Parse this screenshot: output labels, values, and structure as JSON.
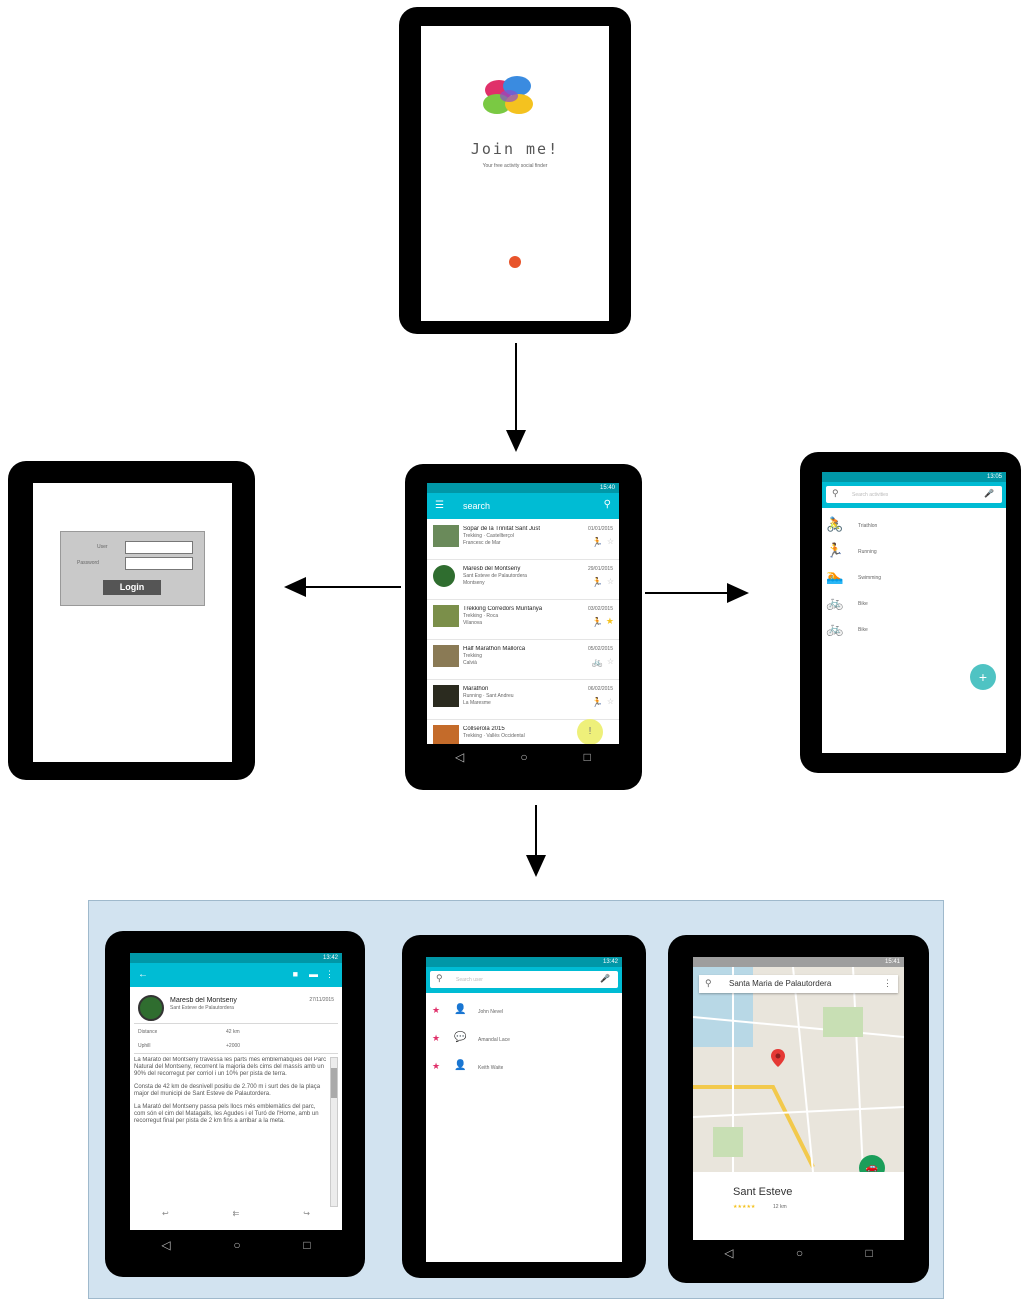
{
  "splash": {
    "title": "Join me!",
    "subtitle": "Your free activity social finder",
    "accent_dot_color": "#e8542b"
  },
  "login": {
    "user_label": "User",
    "password_label": "Password",
    "login_button": "Login"
  },
  "main_list": {
    "status_time": "15:40",
    "search_placeholder": "search",
    "items": [
      {
        "title": "Sopar de la Trinitat Sant Just",
        "sub": "Trekking · Castellterçol",
        "sub2": "Francesc de Mar",
        "date": "01/01/2015"
      },
      {
        "title": "Maresb del Montseny",
        "sub": "Sant Esteve de Palautordera",
        "sub2": "Montseny",
        "date": "29/01/2015"
      },
      {
        "title": "Trekking Corredors Muntanya",
        "sub": "Trekking · Roca",
        "sub2": "Vilanova",
        "date": "03/02/2015"
      },
      {
        "title": "Half Marathon Mallorca",
        "sub": "Trekking",
        "sub2": "Calvià",
        "date": "05/02/2015"
      },
      {
        "title": "Marathon",
        "sub": "Running · Sant Andreu",
        "sub2": "La Maresme",
        "date": "06/02/2015"
      },
      {
        "title": "Collserola 2015",
        "sub": "Trekking · Vallès Occidental",
        "sub2": "",
        "date": ""
      }
    ]
  },
  "sports": {
    "status_time": "13:05",
    "search_placeholder": "Search activities",
    "items": [
      "Triathlon",
      "Running",
      "Swimming",
      "Bike",
      "Bike"
    ],
    "fab_label": "+"
  },
  "detail": {
    "status_time": "13:42",
    "title": "Maresb del Montseny",
    "subtitle": "Sant Esteve de Palautordera",
    "date": "27/11/2015",
    "row1_label": "Distance",
    "row1_value": "42 km",
    "row2_label": "Uphill",
    "row2_value": "+2000",
    "paragraph1": "La Marató del Montseny travessa les parts més emblemàtiques del Parc Natural del Montseny, recorrent la majoria dels cims del massís amb un 90% del recorregut per corriol i un 10% per pista de terra.",
    "paragraph2": "Consta de 42 km de desnivell positiu de 2.700 m i surt des de la plaça major del municipi de Sant Esteve de Palautordera.",
    "paragraph3": "La Marató del Montseny passa pels llocs més emblemàtics del parc, com són el cim del Matagalls, les Agudes i el Turó de l'Home, amb un recorregut final per pista de 2 km fins a arribar a la meta."
  },
  "participants": {
    "status_time": "13:42",
    "search_placeholder": "Search user",
    "users": [
      "John Nevel",
      "Amandal Lace",
      "Keith Waite"
    ]
  },
  "map": {
    "status_time": "15:41",
    "search_value": "Santa Maria de Palautordera",
    "place_name": "Sant Esteve",
    "rating_text": "★★★★★",
    "distance_text": "12 km"
  }
}
